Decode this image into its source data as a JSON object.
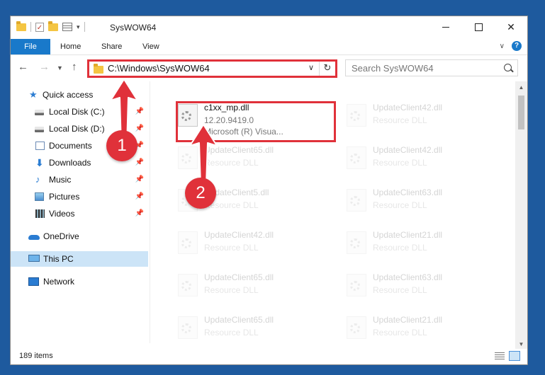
{
  "window": {
    "title": "SysWOW64",
    "min_label": "—",
    "close_label": "✕"
  },
  "ribbon": {
    "tabs": [
      {
        "label": "File"
      },
      {
        "label": "Home"
      },
      {
        "label": "Share"
      },
      {
        "label": "View"
      }
    ],
    "chevron": "∨",
    "help": "?"
  },
  "address": {
    "path": "C:\\Windows\\SysWOW64",
    "dropdown": "∨",
    "refresh": "↻"
  },
  "search": {
    "placeholder": "Search SysWOW64"
  },
  "sidebar": {
    "items": [
      {
        "label": "Quick access",
        "icon": "star-icon"
      },
      {
        "label": "Local Disk (C:)",
        "icon": "drive-icon",
        "pinned": true
      },
      {
        "label": "Local Disk (D:)",
        "icon": "drive-icon",
        "pinned": true
      },
      {
        "label": "Documents",
        "icon": "documents-icon",
        "pinned": true
      },
      {
        "label": "Downloads",
        "icon": "download-icon",
        "pinned": true
      },
      {
        "label": "Music",
        "icon": "music-icon",
        "pinned": true
      },
      {
        "label": "Pictures",
        "icon": "pictures-icon",
        "pinned": true
      },
      {
        "label": "Videos",
        "icon": "videos-icon",
        "pinned": true
      },
      {
        "label": "OneDrive",
        "icon": "onedrive-icon"
      },
      {
        "label": "This PC",
        "icon": "computer-icon",
        "selected": true
      },
      {
        "label": "Network",
        "icon": "network-icon"
      }
    ]
  },
  "files": [
    {
      "name": "c1xx_mp.dll",
      "line1": "12.20.9419.0",
      "line2": "Microsoft (R) Visua...",
      "highlighted": true
    },
    {
      "name": "UpdateClient42.dll",
      "line1": "Resource DLL",
      "line2": ""
    },
    {
      "name": "UpdateClient65.dll",
      "line1": "Resource DLL",
      "line2": ""
    },
    {
      "name": "UpdateClient42.dll",
      "line1": "Resource DLL",
      "line2": ""
    },
    {
      "name": "UpdateClient5.dll",
      "line1": "Resource DLL",
      "line2": ""
    },
    {
      "name": "UpdateClient63.dll",
      "line1": "Resource DLL",
      "line2": ""
    },
    {
      "name": "UpdateClient42.dll",
      "line1": "Resource DLL",
      "line2": ""
    },
    {
      "name": "UpdateClient21.dll",
      "line1": "Resource DLL",
      "line2": ""
    },
    {
      "name": "UpdateClient65.dll",
      "line1": "Resource DLL",
      "line2": ""
    },
    {
      "name": "UpdateClient63.dll",
      "line1": "Resource DLL",
      "line2": ""
    },
    {
      "name": "UpdateClient65.dll",
      "line1": "Resource DLL",
      "line2": ""
    },
    {
      "name": "UpdateClient21.dll",
      "line1": "Resource DLL",
      "line2": ""
    }
  ],
  "status": {
    "item_count": "189 items"
  },
  "callouts": [
    {
      "number": "1",
      "target": "address-bar"
    },
    {
      "number": "2",
      "target": "c1xx_mp.dll"
    }
  ],
  "colors": {
    "accent": "#1979ca",
    "highlight": "#e0313a",
    "selection": "#cce4f7"
  }
}
